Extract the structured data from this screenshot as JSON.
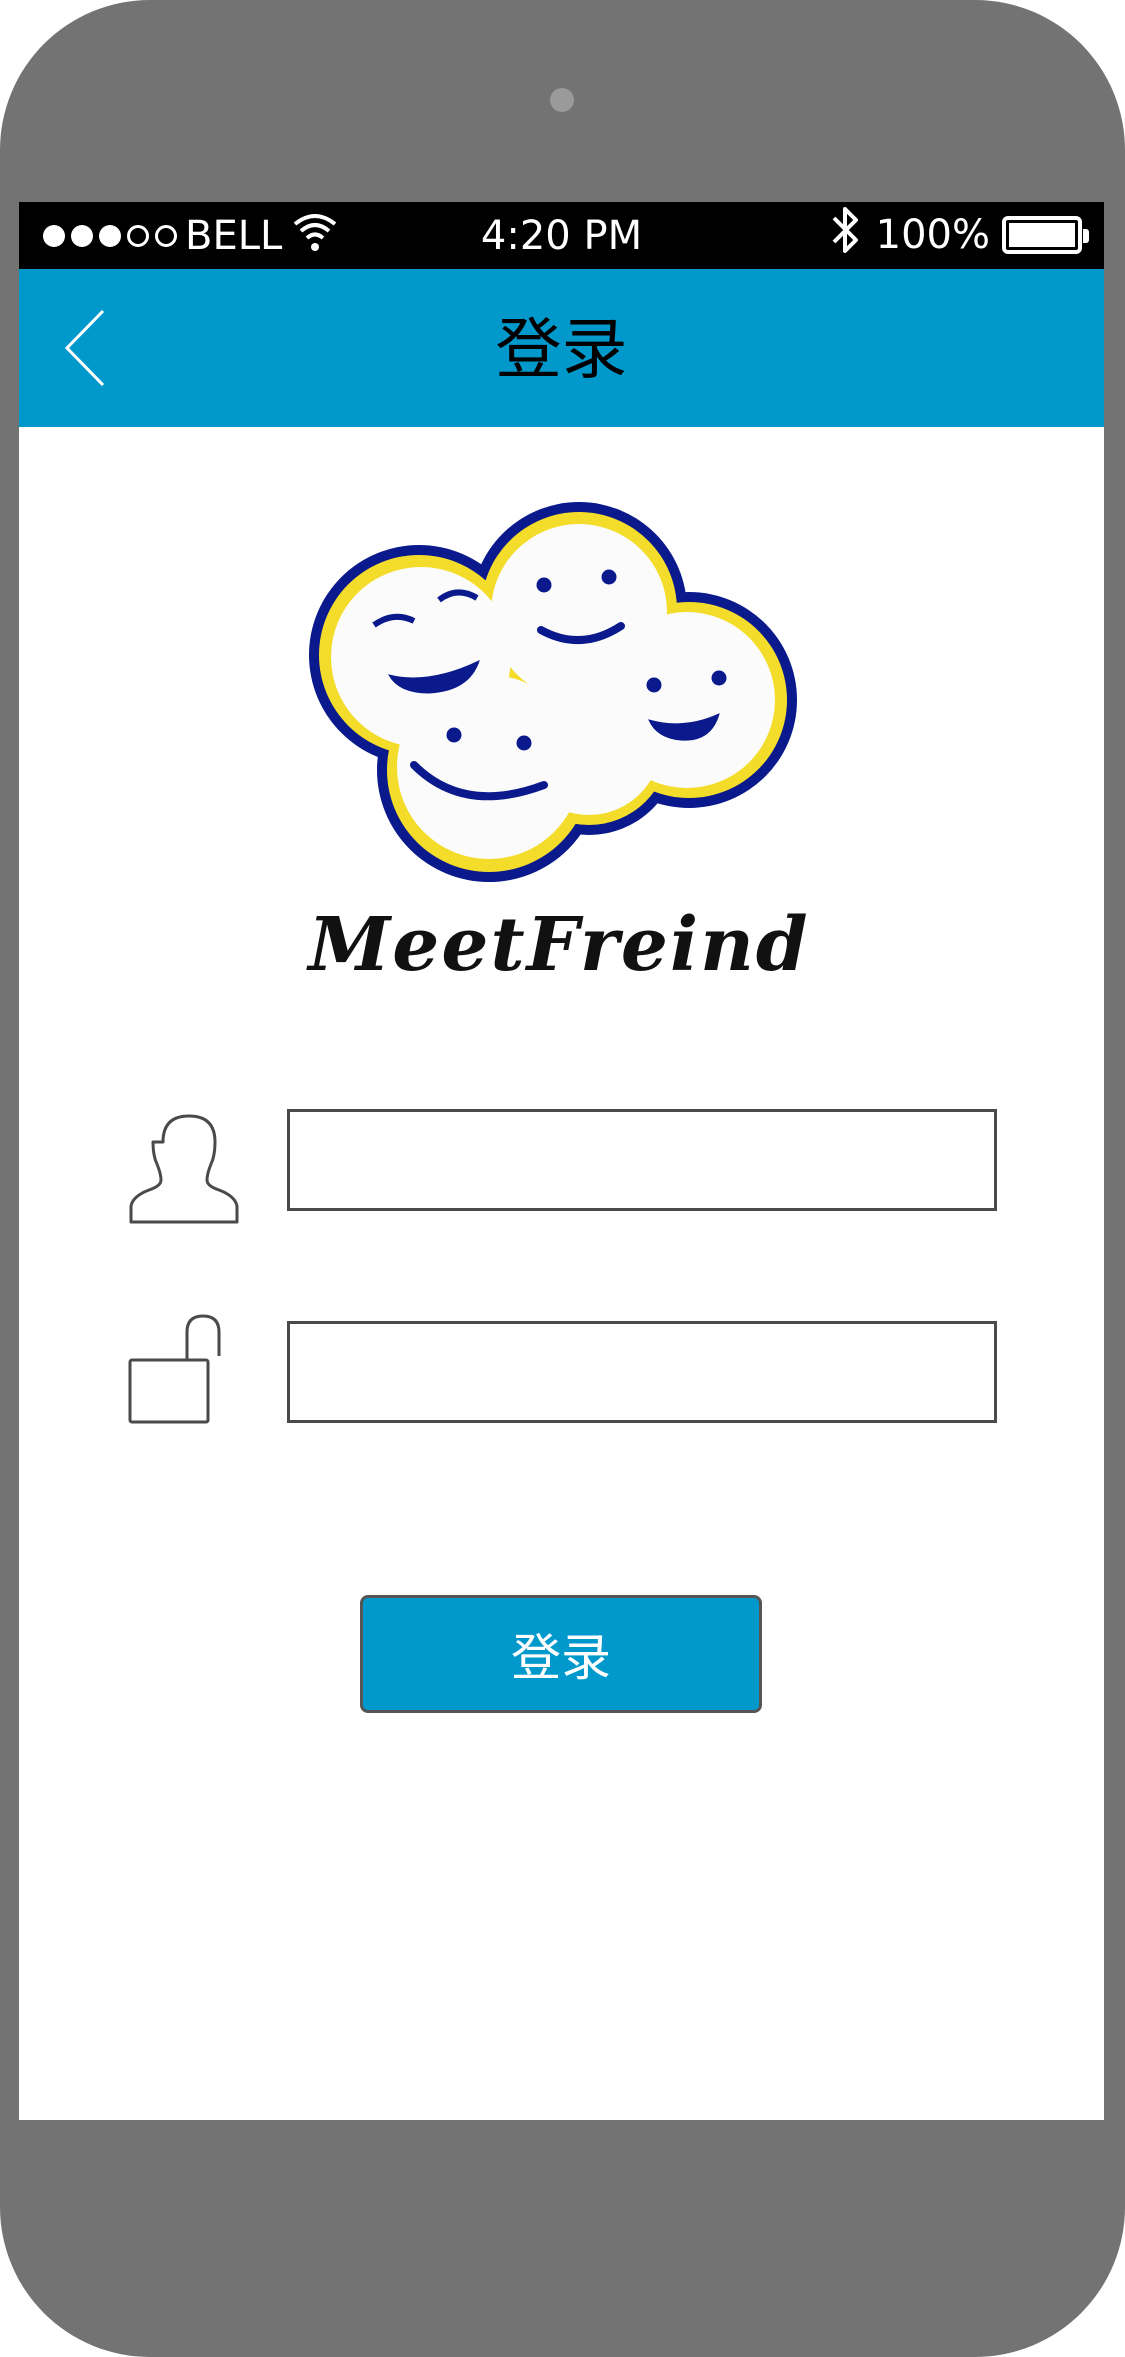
{
  "status_bar": {
    "signal_filled": 3,
    "signal_empty": 2,
    "carrier": "BELL",
    "wifi_icon": "wifi-icon",
    "time": "4:20 PM",
    "bluetooth_icon": "bluetooth-icon",
    "battery_percent": "100%",
    "battery_level": 1.0
  },
  "nav_bar": {
    "back_icon": "chevron-left-icon",
    "title": "登录"
  },
  "app": {
    "logo_icon": "smiling-cloud-logo",
    "name": "MeetFreind"
  },
  "form": {
    "username": {
      "icon": "user-icon",
      "value": "",
      "placeholder": ""
    },
    "password": {
      "icon": "unlock-icon",
      "value": "",
      "placeholder": ""
    },
    "login_label": "登录"
  },
  "colors": {
    "accent": "#0199cc",
    "phone_body": "#737373",
    "status_bar": "#000000"
  }
}
